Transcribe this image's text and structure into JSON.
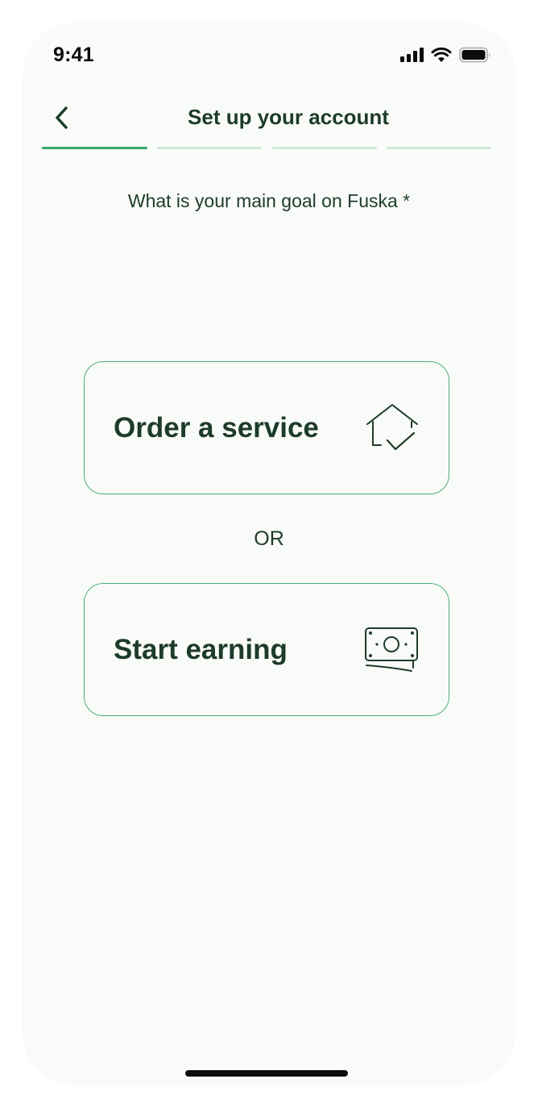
{
  "status_bar": {
    "time": "9:41",
    "icons": [
      "signal-icon",
      "wifi-icon",
      "battery-icon"
    ]
  },
  "header": {
    "back_icon": "chevron-left-icon",
    "title": "Set up your account"
  },
  "progress": {
    "total_steps": 4,
    "current_step": 1
  },
  "question": "What is your main goal on Fuska *",
  "options": [
    {
      "label": "Order a service",
      "icon": "house-check-icon"
    },
    {
      "label": "Start earning",
      "icon": "money-bill-icon"
    }
  ],
  "separator": "OR",
  "colors": {
    "text": "#1d3b2a",
    "accent": "#4caf78",
    "progress_active": "#3aa76a",
    "progress_inactive": "#cfe8d7",
    "background": "#f9fbf9"
  }
}
